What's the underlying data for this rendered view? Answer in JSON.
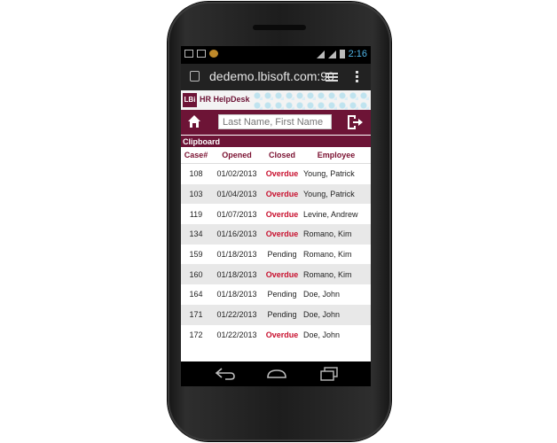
{
  "status_bar": {
    "time": "2:16"
  },
  "browser": {
    "url": "dedemo.lbisoft.com:90"
  },
  "brand": {
    "logo": "LBi",
    "name": "HR HelpDesk"
  },
  "search": {
    "placeholder": "Last Name, First Name"
  },
  "clipboard": {
    "title": "Clipboard",
    "columns": [
      "Case#",
      "Opened",
      "Closed",
      "Employee"
    ],
    "rows": [
      {
        "case": "108",
        "opened": "01/02/2013",
        "closed": "Overdue",
        "employee": "Young, Patrick"
      },
      {
        "case": "103",
        "opened": "01/04/2013",
        "closed": "Overdue",
        "employee": "Young, Patrick"
      },
      {
        "case": "119",
        "opened": "01/07/2013",
        "closed": "Overdue",
        "employee": "Levine, Andrew"
      },
      {
        "case": "134",
        "opened": "01/16/2013",
        "closed": "Overdue",
        "employee": "Romano, Kim"
      },
      {
        "case": "159",
        "opened": "01/18/2013",
        "closed": "Pending",
        "employee": "Romano, Kim"
      },
      {
        "case": "160",
        "opened": "01/18/2013",
        "closed": "Overdue",
        "employee": "Romano, Kim"
      },
      {
        "case": "164",
        "opened": "01/18/2013",
        "closed": "Pending",
        "employee": "Doe, John"
      },
      {
        "case": "171",
        "opened": "01/22/2013",
        "closed": "Pending",
        "employee": "Doe, John"
      },
      {
        "case": "172",
        "opened": "01/22/2013",
        "closed": "Overdue",
        "employee": "Doe, John"
      }
    ]
  },
  "colors": {
    "brand": "#6d1436",
    "overdue": "#c8102e",
    "clock": "#4fb3e6"
  },
  "icons": {
    "home": "home-icon",
    "logout": "logout-icon",
    "back": "back-icon",
    "home_nav": "home-nav-icon",
    "recent": "recent-apps-icon",
    "tabs": "tabs-icon",
    "menu": "overflow-menu-icon"
  }
}
